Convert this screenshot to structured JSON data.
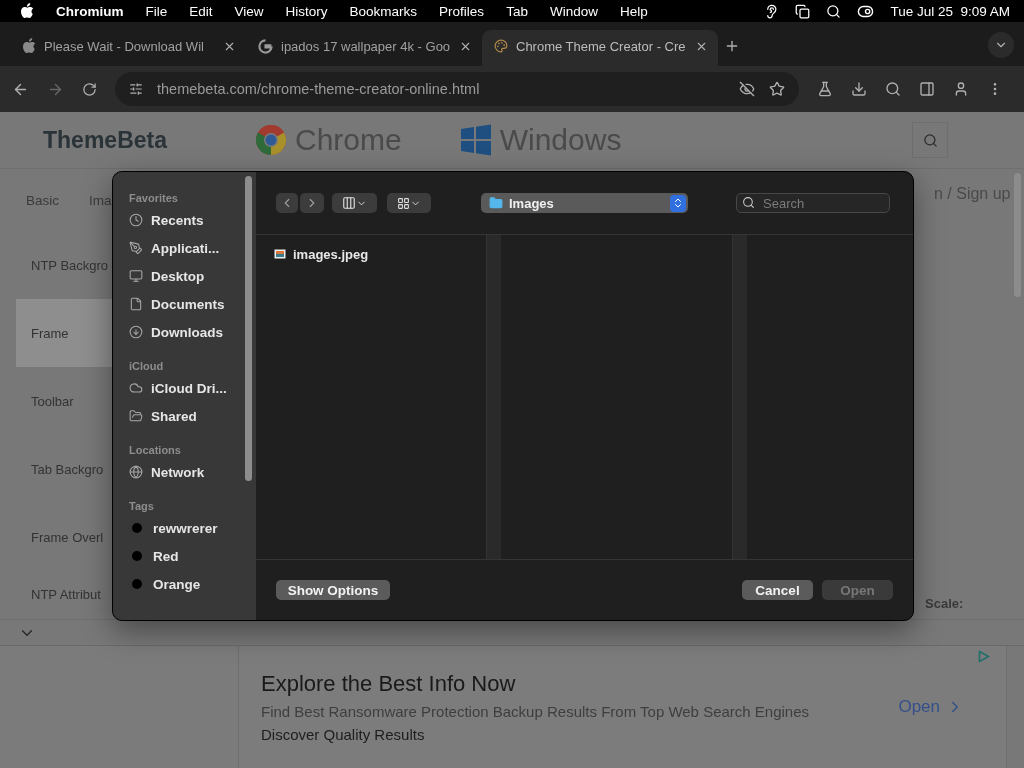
{
  "menu_bar": {
    "app": "Chromium",
    "menus": [
      "File",
      "Edit",
      "View",
      "History",
      "Bookmarks",
      "Profiles",
      "Tab",
      "Window",
      "Help"
    ],
    "clock": "Tue Jul 25  9:09 AM"
  },
  "tabs": [
    {
      "title": "Please Wait - Download Wil",
      "kind": "apple",
      "selected": false
    },
    {
      "title": "ipados 17 wallpaper 4k - Goo",
      "kind": "google",
      "selected": false
    },
    {
      "title": "Chrome Theme Creator - Cre",
      "kind": "palette",
      "selected": true
    }
  ],
  "address": {
    "url": "themebeta.com/chrome-theme-creator-online.html"
  },
  "page": {
    "logo": "ThemeBeta",
    "platforms": [
      {
        "label": "Chrome",
        "kind": "chrome"
      },
      {
        "label": "Windows",
        "kind": "windows"
      }
    ],
    "tabs": [
      "Basic",
      "Ima"
    ],
    "items": [
      {
        "label": "NTP Backgro",
        "selected": false
      },
      {
        "label": "Frame",
        "selected": true
      },
      {
        "label": "Toolbar",
        "selected": false
      },
      {
        "label": "Tab Backgro",
        "selected": false
      },
      {
        "label": "Frame Overl",
        "selected": false
      },
      {
        "label": "NTP Attribut",
        "selected": false
      }
    ],
    "sign_link": "n / Sign up",
    "scale_label": "Scale:"
  },
  "dialog": {
    "sidebar": [
      {
        "heading": "Favorites",
        "items": [
          {
            "label": "Recents",
            "kind": "clock"
          },
          {
            "label": "Applicati...",
            "kind": "apps"
          },
          {
            "label": "Desktop",
            "kind": "desktop"
          },
          {
            "label": "Documents",
            "kind": "document"
          },
          {
            "label": "Downloads",
            "kind": "download"
          }
        ]
      },
      {
        "heading": "iCloud",
        "items": [
          {
            "label": "iCloud Dri...",
            "kind": "cloud"
          },
          {
            "label": "Shared",
            "kind": "shared"
          }
        ]
      },
      {
        "heading": "Locations",
        "items": [
          {
            "label": "Network",
            "kind": "network"
          }
        ]
      },
      {
        "heading": "Tags",
        "items": [
          {
            "label": "rewwrerer",
            "kind": "tag"
          },
          {
            "label": "Red",
            "kind": "tag"
          },
          {
            "label": "Orange",
            "kind": "tag"
          }
        ]
      }
    ],
    "location": "Images",
    "search": {
      "placeholder": "Search"
    },
    "files": [
      {
        "name": "images.jpeg"
      }
    ],
    "buttons": [
      {
        "label": "Show Options",
        "disabled": false
      },
      {
        "label": "Cancel",
        "disabled": false
      },
      {
        "label": "Open",
        "disabled": true
      }
    ]
  },
  "ad": {
    "title": "Explore the Best Info Now",
    "description": "Find Best Ransomware Protection Backup Results From Top Web Search Engines",
    "subtitle": "Discover Quality Results",
    "action": "Open"
  }
}
